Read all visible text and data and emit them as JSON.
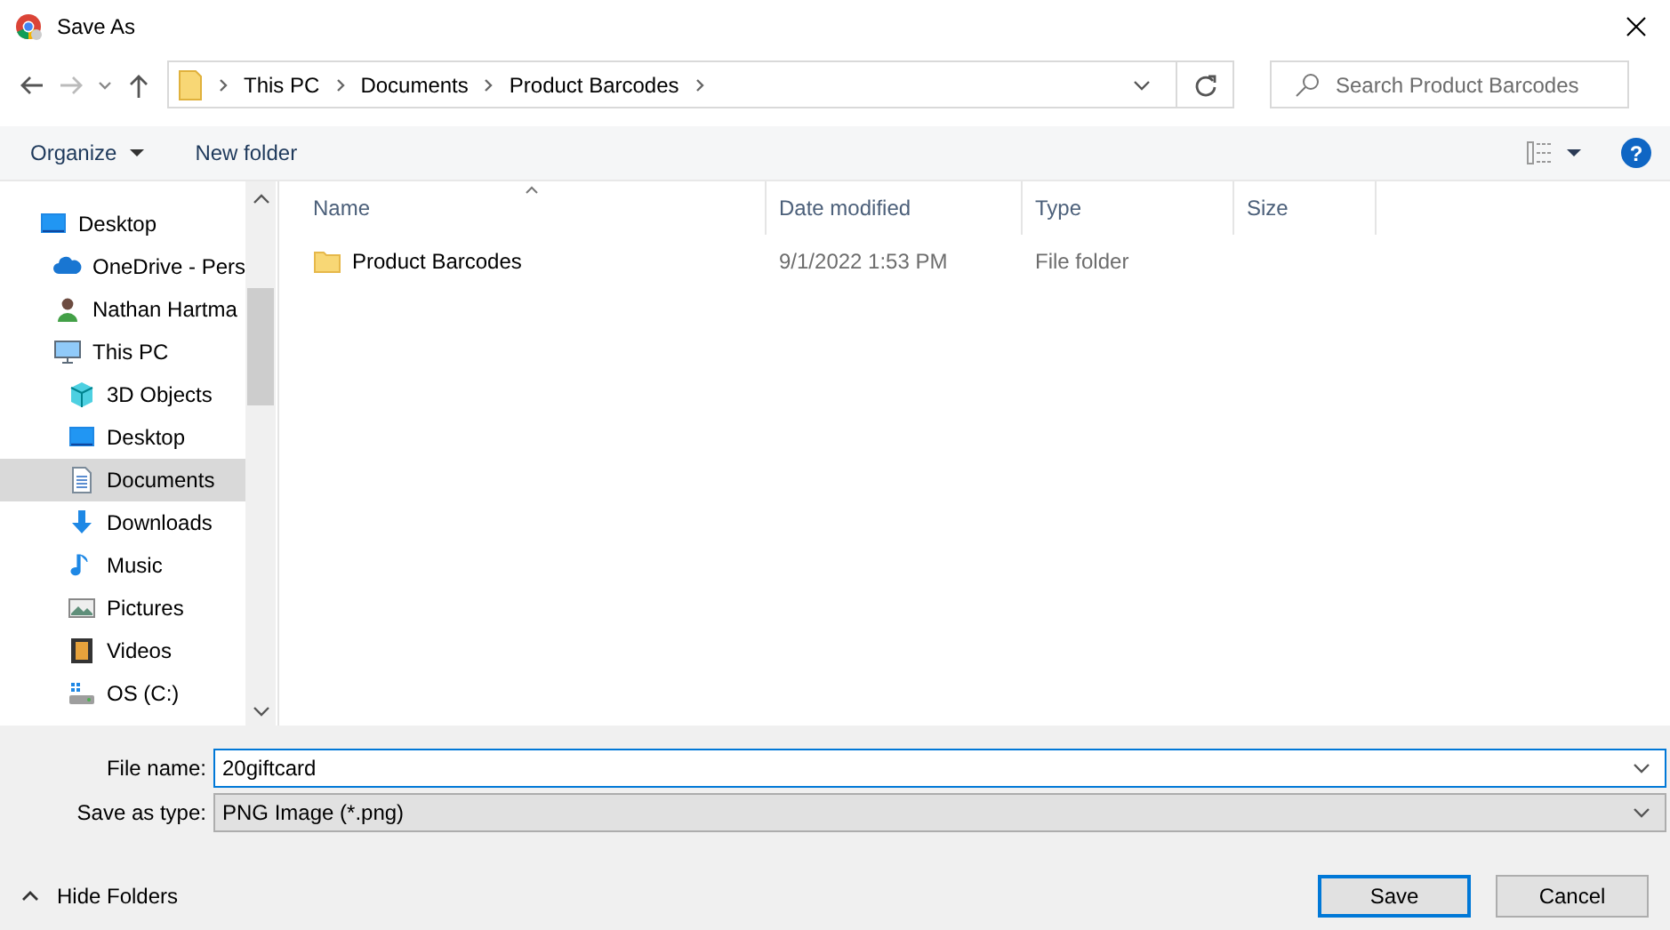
{
  "window": {
    "title": "Save As"
  },
  "address_bar": {
    "crumbs": [
      "This PC",
      "Documents",
      "Product Barcodes"
    ]
  },
  "search": {
    "placeholder": "Search Product Barcodes"
  },
  "toolbar": {
    "buttons": [
      "Organize",
      "New folder"
    ]
  },
  "sidebar": {
    "items": [
      {
        "label": "Desktop",
        "kind": "desktop",
        "selected": false,
        "children": [
          {
            "label": "OneDrive - Pers",
            "kind": "cloud",
            "selected": false
          },
          {
            "label": "Nathan Hartma",
            "kind": "person",
            "selected": false
          },
          {
            "label": "This PC",
            "kind": "pc",
            "selected": false,
            "children": [
              {
                "label": "3D Objects",
                "kind": "cube",
                "selected": false
              },
              {
                "label": "Desktop",
                "kind": "desktop",
                "selected": false
              },
              {
                "label": "Documents",
                "kind": "document",
                "selected": true
              },
              {
                "label": "Downloads",
                "kind": "download",
                "selected": false
              },
              {
                "label": "Music",
                "kind": "music",
                "selected": false
              },
              {
                "label": "Pictures",
                "kind": "picture",
                "selected": false
              },
              {
                "label": "Videos",
                "kind": "video",
                "selected": false
              },
              {
                "label": "OS (C:)",
                "kind": "drive",
                "selected": false
              }
            ]
          }
        ]
      }
    ]
  },
  "table": {
    "columns": [
      "Name",
      "Date modified",
      "Type",
      "Size"
    ],
    "rows": [
      {
        "name": "Product Barcodes",
        "date": "9/1/2022 1:53 PM",
        "type": "File folder",
        "selected": false
      }
    ]
  },
  "form": {
    "file_name_label": "File name:",
    "file_name": "20giftcard",
    "type_label": "Save as type:",
    "type_value": "PNG Image (*.png)"
  },
  "hide_folders": "Hide Folders",
  "help": "?",
  "buttons": [
    {
      "label": "Save",
      "default": true
    },
    {
      "label": "Cancel",
      "default": false
    }
  ]
}
